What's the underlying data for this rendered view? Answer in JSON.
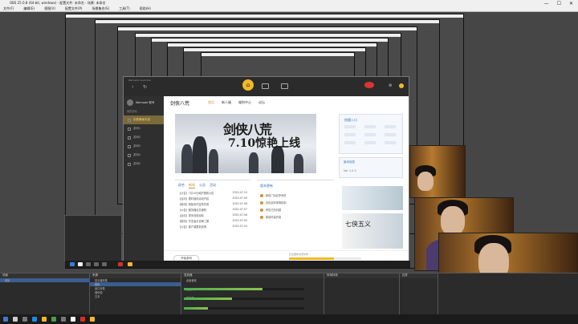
{
  "window": {
    "title": "OBS 25.0.8 (64-bit, windows) - 配置文件: 未命名 - 场景: 未命名",
    "controls": [
      "—",
      "☐",
      "✕"
    ]
  },
  "menubar": {
    "items": [
      "文件(F)",
      "编辑(E)",
      "视图(V)",
      "配置文件(P)",
      "场景集合(S)",
      "工具(T)",
      "帮助(H)"
    ]
  },
  "launcher": {
    "title": "Wemade Launcher",
    "user_label": "Wemade 账号",
    "sidebar": {
      "section": "我的游戏",
      "items": [
        "剑侠情缘手游",
        "游戏1",
        "游戏2",
        "游戏3",
        "游戏4",
        "游戏5"
      ]
    },
    "nav": {
      "logo": "剑侠八荒",
      "items": [
        "首页",
        "新人福",
        "福利中心",
        "论坛"
      ]
    },
    "banner": {
      "title": "剑侠八荒",
      "subtitle": "7.10惊艳上线"
    },
    "info": {
      "header": "快捷入口",
      "version_label": "版本信息",
      "version_value": "Ver 1.0.5"
    },
    "news": {
      "tabs": [
        "综合",
        "新闻",
        "公告",
        "活动"
      ],
      "rows": [
        {
          "title": "【公告】7月10日维护更新公告",
          "date": "2020-07-10"
        },
        {
          "title": "【活动】限时福利活动开启",
          "date": "2020-07-09"
        },
        {
          "title": "【新闻】新版本内容抢先看",
          "date": "2020-07-08"
        },
        {
          "title": "【公告】服务器合并通知",
          "date": "2020-07-07"
        },
        {
          "title": "【活动】周末双倍经验",
          "date": "2020-07-06"
        },
        {
          "title": "【新闻】开发者访谈第三期",
          "date": "2020-07-05"
        },
        {
          "title": "【公告】客户端更新说明",
          "date": "2020-07-04"
        }
      ]
    },
    "updates": {
      "header": "版本更新",
      "rows": [
        "新增门派武学系统",
        "优化副本掉落机制",
        "修复已知问题",
        "新增时装外观"
      ]
    },
    "ad2_text": "七侠五义",
    "start_label": "开始游戏",
    "progress_text": "正在更新资源文件...",
    "progress_fraction": 0.62
  },
  "dock": {
    "scenes": {
      "header": "场景",
      "items": [
        "场景"
      ]
    },
    "sources": {
      "header": "来源",
      "items": [
        "显示器采集",
        "图像",
        "窗口采集",
        "媒体源",
        "文本"
      ]
    },
    "mixer": {
      "header": "混音器",
      "tracks": [
        {
          "name": "桌面音频",
          "level": 0.65
        },
        {
          "name": "麦克风/Aux",
          "level": 0.4
        },
        {
          "name": "媒体源",
          "level": 0.2
        }
      ]
    },
    "transitions": {
      "header": "转场特效"
    },
    "controls": {
      "header": "控件"
    }
  }
}
